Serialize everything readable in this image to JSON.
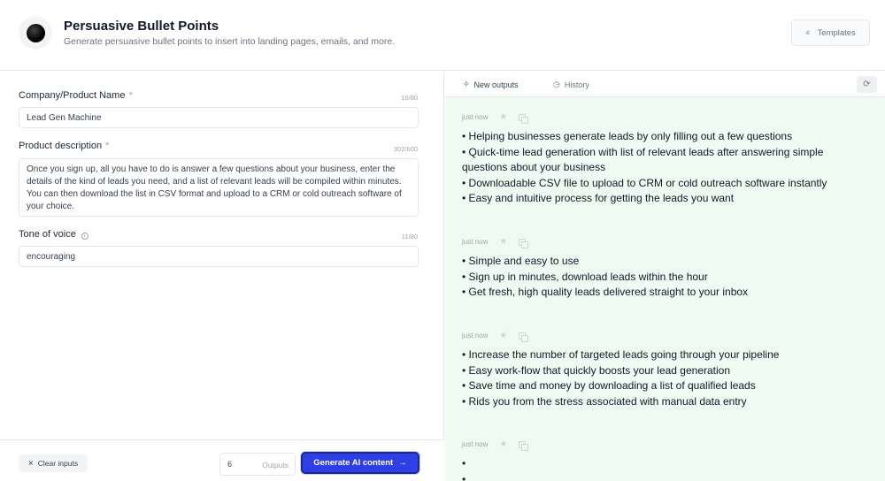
{
  "header": {
    "title": "Persuasive Bullet Points",
    "subtitle": "Generate persuasive bullet points to insert into landing pages, emails, and more.",
    "templates_label": "Templates",
    "logo_icon": "black-sphere-icon"
  },
  "form": {
    "company": {
      "label": "Company/Product Name",
      "required_mark": "*",
      "counter": "16/80",
      "value": "Lead Gen Machine"
    },
    "description": {
      "label": "Product description",
      "required_mark": "*",
      "counter": "302/600",
      "value": "Once you sign up, all you have to do is answer a few questions about your business, enter the details of the kind of leads you need, and a list of relevant leads will be compiled within minutes. You can then download the list in CSV format and upload to a CRM or cold outreach software of your choice."
    },
    "tone": {
      "label": "Tone of voice",
      "counter": "11/80",
      "value": "encouraging"
    }
  },
  "footer": {
    "clear_label": "Clear inputs",
    "outputs_count": "6",
    "outputs_label": "Outputs",
    "generate_label": "Generate AI content"
  },
  "tabs": {
    "new_outputs": "New outputs",
    "history": "History"
  },
  "outputs": [
    {
      "time": "just now",
      "lines": [
        "• Helping businesses generate leads by only filling out a few questions",
        "• Quick-time lead generation with list of relevant leads after answering simple questions about your business",
        "• Downloadable CSV file to upload to CRM or cold outreach software instantly",
        "• Easy and intuitive process for getting the leads you want"
      ]
    },
    {
      "time": "just now",
      "lines": [
        "• Simple and easy to use",
        "• Sign up in minutes, download leads within the hour",
        "• Get fresh, high quality leads delivered straight to your inbox"
      ]
    },
    {
      "time": "just now",
      "lines": [
        "• Increase the number of targeted leads going through your pipeline",
        "• Easy work-flow that quickly boosts your lead generation",
        "• Save time and money by downloading a list of qualified leads",
        "• Rids you from the stress associated with manual data entry"
      ]
    },
    {
      "time": "just now",
      "lines": [
        "•",
        "•"
      ]
    }
  ],
  "colors": {
    "accent": "#2f3fe5",
    "output_bg": "#effbf2"
  }
}
